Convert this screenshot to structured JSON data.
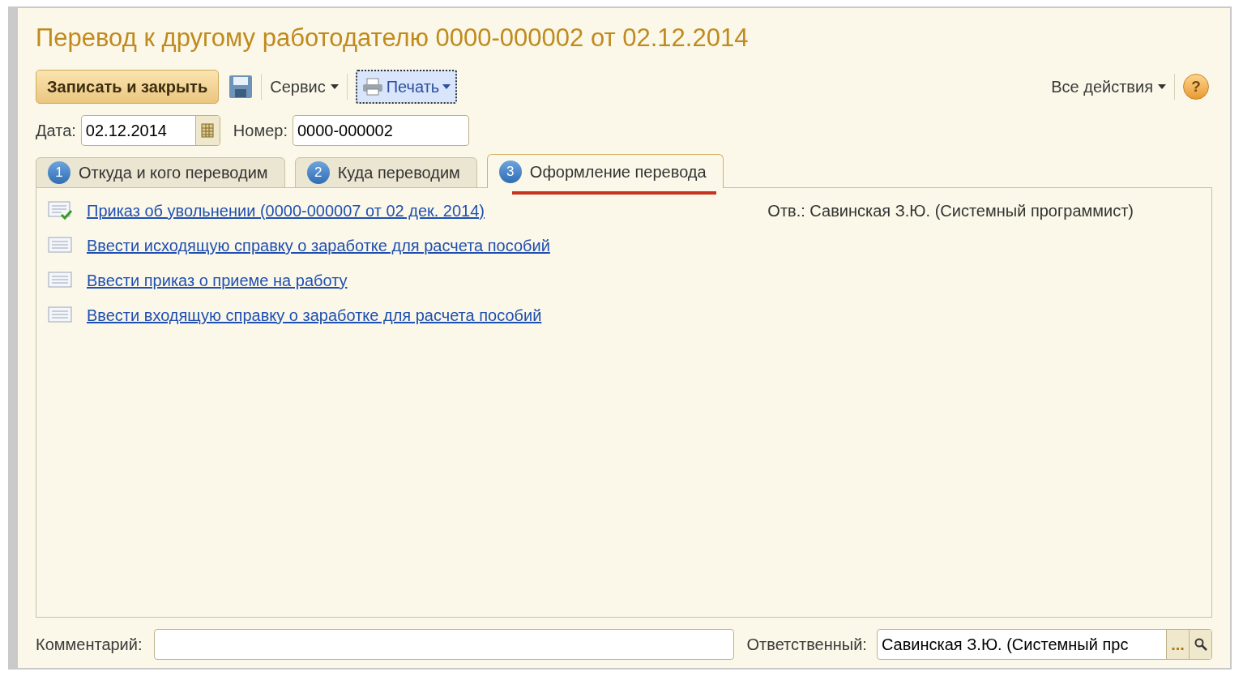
{
  "window": {
    "title": "Перевод к другому работодателю 0000-000002 от 02.12.2014"
  },
  "toolbar": {
    "save_close": "Записать и закрыть",
    "service": "Сервис",
    "print": "Печать",
    "all_actions": "Все действия",
    "help": "?"
  },
  "fields": {
    "date_label": "Дата:",
    "date": "02.12.2014",
    "number_label": "Номер:",
    "number": "0000-000002"
  },
  "tabs": [
    {
      "number": "1",
      "label": "Откуда и кого переводим",
      "selected": false
    },
    {
      "number": "2",
      "label": "Куда переводим",
      "selected": false
    },
    {
      "number": "3",
      "label": "Оформление перевода",
      "selected": true
    }
  ],
  "tasks": [
    {
      "kind": "done",
      "label": "Приказ об увольнении (0000-000007 от 02 дек. 2014)",
      "note": "Отв.: Савинская З.Ю. (Системный программист)"
    },
    {
      "kind": "todo",
      "label": "Ввести исходящую справку о заработке для расчета пособий"
    },
    {
      "kind": "todo",
      "label": "Ввести приказ о приеме на работу"
    },
    {
      "kind": "todo",
      "label": "Ввести входящую справку о заработке для расчета пособий"
    }
  ],
  "footer": {
    "comment_label": "Комментарий:",
    "responsible_label": "Ответственный:",
    "responsible": "Савинская З.Ю. (Системный прс",
    "more": "..."
  }
}
